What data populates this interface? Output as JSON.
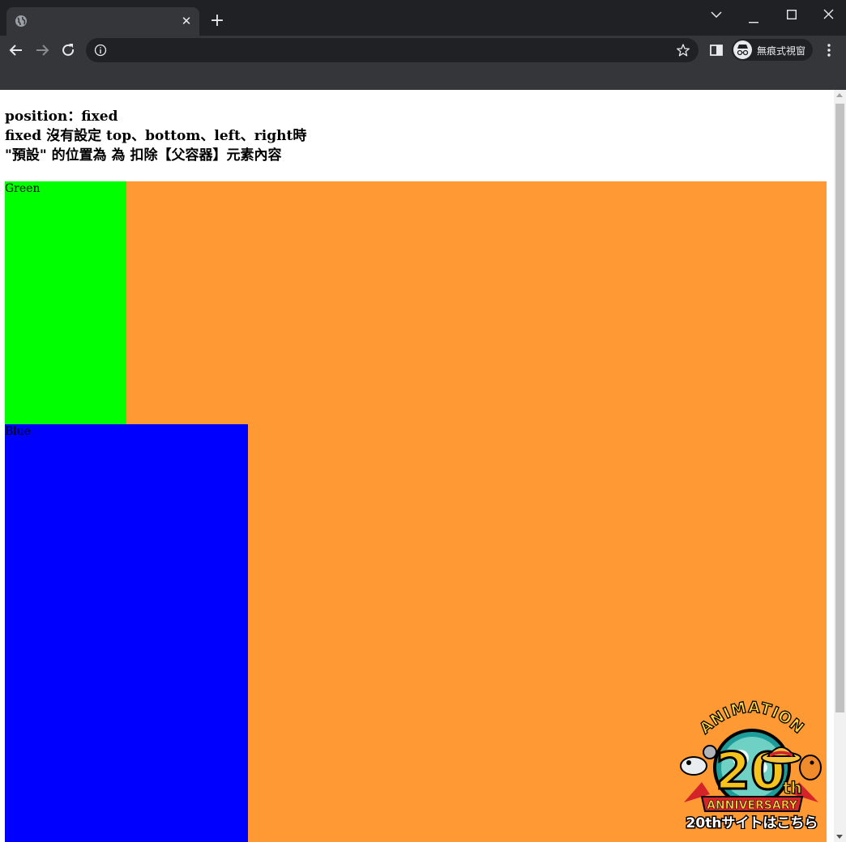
{
  "browser": {
    "tab": {
      "title": "",
      "close_icon": "close-icon"
    },
    "new_tab_icon": "plus-icon",
    "window_controls": [
      "tab-search-icon",
      "minimize-icon",
      "maximize-icon",
      "close-window-icon"
    ],
    "omnibox": {
      "url": "",
      "info_icon": "info-icon",
      "bookmark_icon": "star-icon"
    },
    "profile": {
      "label": "無痕式視窗",
      "icon": "incognito-icon"
    },
    "colors": {
      "frame": "#202124",
      "toolbar": "#35363a",
      "text": "#e8eaed"
    }
  },
  "page": {
    "heading_lines": [
      "position：fixed",
      "fixed 沒有設定 top、bottom、left、right時",
      "\"預設\" 的位置為 為 扣除【父容器】元素內容"
    ],
    "container_color": "#ff9933",
    "boxes": [
      {
        "label": "Green",
        "color": "#00ff00"
      },
      {
        "label": "Blue",
        "color": "#0000ff"
      }
    ],
    "badge": {
      "top_text": "ANIMATION",
      "number": "20",
      "suffix": "th",
      "ribbon_text": "ANNIVERSARY",
      "link_text": "20thサイトはこちら"
    }
  }
}
